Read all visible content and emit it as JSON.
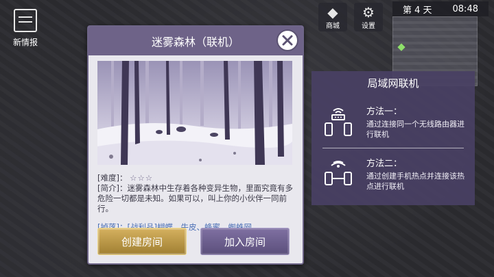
{
  "news": {
    "label": "新情报",
    "icon": "scroll-icon"
  },
  "topbar": {
    "shop_label": "商城",
    "settings_label": "设置",
    "day": "第 4 天",
    "time": "08:48"
  },
  "dialog": {
    "title": "迷雾森林（联机）",
    "difficulty_label": "[难度]：",
    "difficulty_stars": "☆☆☆",
    "intro_label": "[简介]：",
    "intro_text": "迷雾森林中生存着各种变异生物，里面究竟有多危险一切都是未知。如果可以，叫上你的小伙伴一同前行。",
    "drops_label": "[掉落]：",
    "drops_text": "[战利品]蝴蝶、牛皮、蜂蜜、蜘蛛网",
    "create_label": "创建房间",
    "join_label": "加入房间"
  },
  "lan": {
    "title": "局域网联机",
    "methods": [
      {
        "name": "方法一：",
        "detail": "通过连接同一个无线路由器进行联机",
        "icon": "wifi-router-icon"
      },
      {
        "name": "方法二：",
        "detail": "通过创建手机热点并连接该热点进行联机",
        "icon": "hotspot-icon"
      }
    ]
  },
  "colors": {
    "header": "#6e6388",
    "create_button": "#c4a24f",
    "join_button": "#6e6192",
    "lan_panel": "#494064"
  }
}
